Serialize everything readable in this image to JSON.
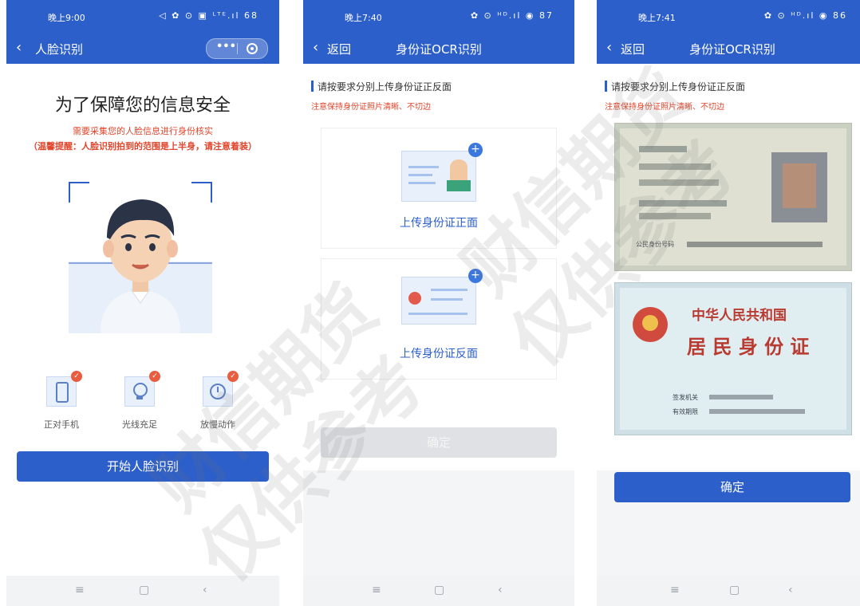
{
  "watermark": {
    "line1": "财信期货",
    "line2": "仅供参考"
  },
  "panel1": {
    "status_time": "晚上9:00",
    "status_icons": "◁ ✿ ⊙ ▣ ᴸᵀᴱ.ıl 68",
    "nav_title": "人脸识别",
    "title": "为了保障您的信息安全",
    "subtitle": "需要采集您的人脸信息进行身份核实",
    "tip": "（温馨提醒：人脸识别拍到的范围是上半身，请注意着装）",
    "checks": [
      {
        "label": "正对手机",
        "icon": "phone-icon"
      },
      {
        "label": "光线充足",
        "icon": "lightbulb-icon"
      },
      {
        "label": "放慢动作",
        "icon": "clock-icon"
      }
    ],
    "start_button": "开始人脸识别"
  },
  "panel2": {
    "status_time": "晚上7:40",
    "status_icons": "✿ ⊙ ᴴᴰ.ıl ◉ 87",
    "back_label": "返回",
    "nav_title": "身份证OCR识别",
    "requirement": "请按要求分别上传身份证正反面",
    "note": "注意保持身份证照片清晰、不切边",
    "front_label": "上传身份证正面",
    "back_upload_label": "上传身份证反面",
    "confirm_button": "确定"
  },
  "panel3": {
    "status_time": "晚上7:41",
    "status_icons": "✿ ⊙ ᴴᴰ.ıl ◉ 86",
    "back_label": "返回",
    "nav_title": "身份证OCR识别",
    "requirement": "请按要求分别上传身份证正反面",
    "note": "注意保持身份证照片清晰、不切边",
    "id_front_text": "公民身份号码",
    "id_back_title1": "中华人民共和国",
    "id_back_title2": "居 民 身 份 证",
    "id_back_issuer": "签发机关",
    "id_back_valid": "有效期限",
    "confirm_button": "确定"
  },
  "bottom_nav": {
    "menu": "≡",
    "home": "▢",
    "back": "‹"
  },
  "colors": {
    "primary": "#2c5fc9",
    "warning": "#e0452b",
    "badge": "#e85d3f"
  }
}
